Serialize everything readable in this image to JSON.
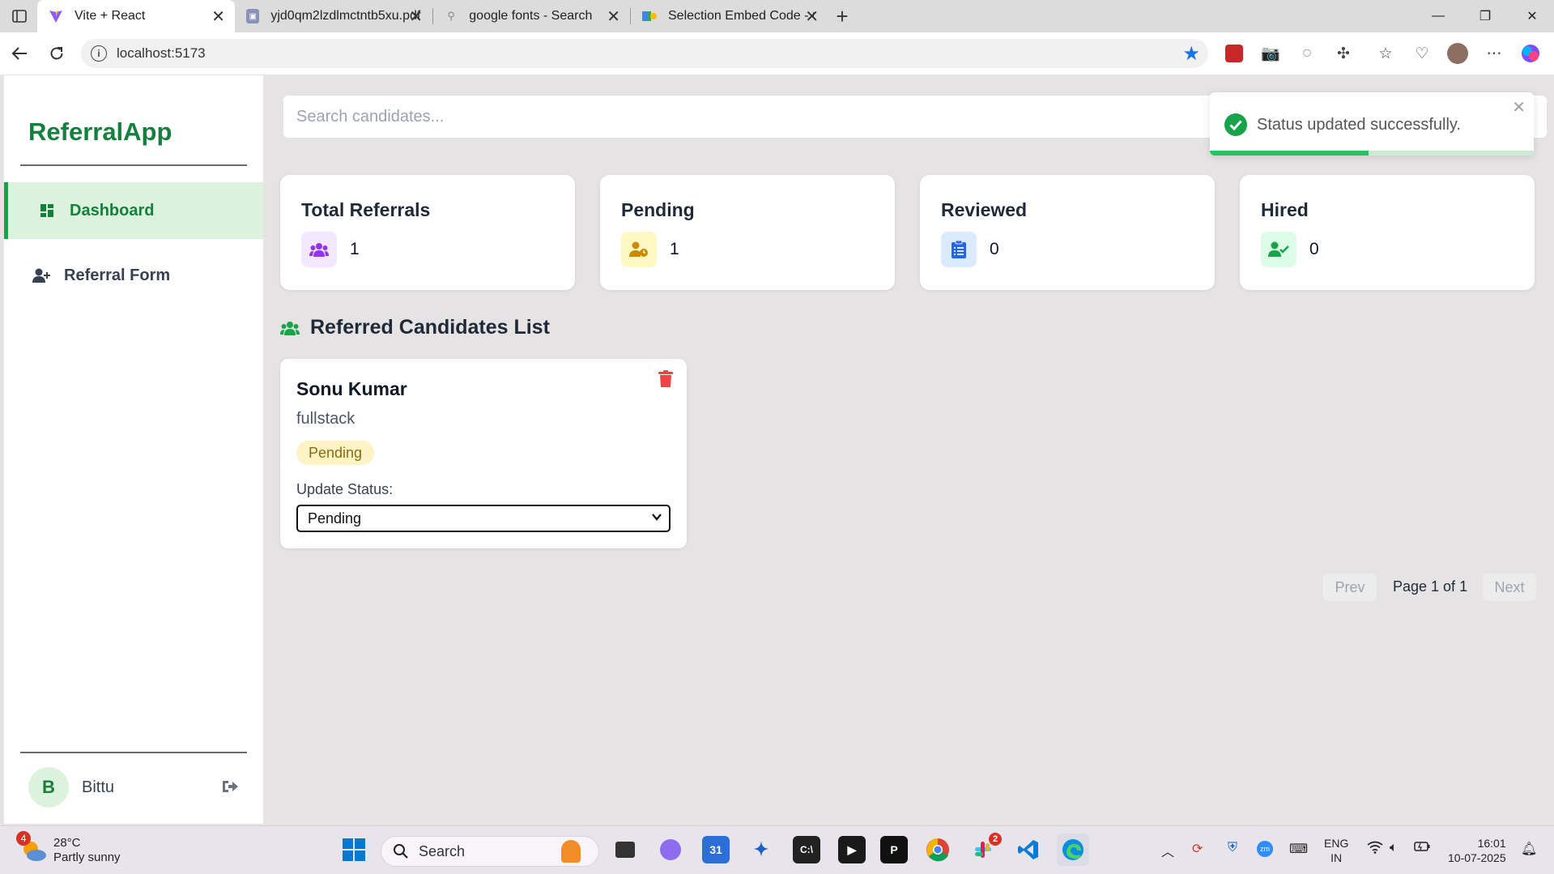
{
  "browser": {
    "tabs": [
      {
        "title": "Vite + React",
        "active": true
      },
      {
        "title": "yjd0qm2lzdlmctntb5xu.pdf",
        "active": false
      },
      {
        "title": "google fonts - Search",
        "active": false
      },
      {
        "title": "Selection Embed Code - Google F",
        "active": false
      }
    ],
    "url": "localhost:5173"
  },
  "sidebar": {
    "logo": "ReferralApp",
    "items": [
      {
        "label": "Dashboard",
        "icon": "dashboard-icon",
        "active": true
      },
      {
        "label": "Referral Form",
        "icon": "user-plus-icon",
        "active": false
      }
    ],
    "user": {
      "initial": "B",
      "name": "Bittu"
    }
  },
  "search": {
    "placeholder": "Search candidates..."
  },
  "stats": [
    {
      "title": "Total Referrals",
      "value": "1",
      "icon": "users-icon",
      "color": "#9333ea",
      "bg": "#f3e8ff"
    },
    {
      "title": "Pending",
      "value": "1",
      "icon": "user-clock-icon",
      "color": "#ca8a04",
      "bg": "#fef9c3"
    },
    {
      "title": "Reviewed",
      "value": "0",
      "icon": "clipboard-list-icon",
      "color": "#2563eb",
      "bg": "#dbeafe"
    },
    {
      "title": "Hired",
      "value": "0",
      "icon": "user-check-icon",
      "color": "#16a34a",
      "bg": "#dcfce7"
    }
  ],
  "list": {
    "heading": "Referred Candidates List",
    "candidates": [
      {
        "name": "Sonu Kumar",
        "role": "fullstack",
        "status": "Pending",
        "update_label": "Update Status:",
        "selected_status": "Pending"
      }
    ]
  },
  "pagination": {
    "prev": "Prev",
    "info": "Page 1 of 1",
    "next": "Next"
  },
  "toast": {
    "message": "Status updated successfully.",
    "progress": 0.49
  },
  "taskbar": {
    "weather": {
      "temp": "28°C",
      "desc": "Partly sunny",
      "badge": "4"
    },
    "search_label": "Search",
    "slack_badge": "2",
    "lang": {
      "line1": "ENG",
      "line2": "IN"
    },
    "time": "16:01",
    "date": "10-07-2025"
  },
  "colors": {
    "accent": "#15803d",
    "active_bg": "#dcf2dd",
    "delete": "#ef4444"
  }
}
